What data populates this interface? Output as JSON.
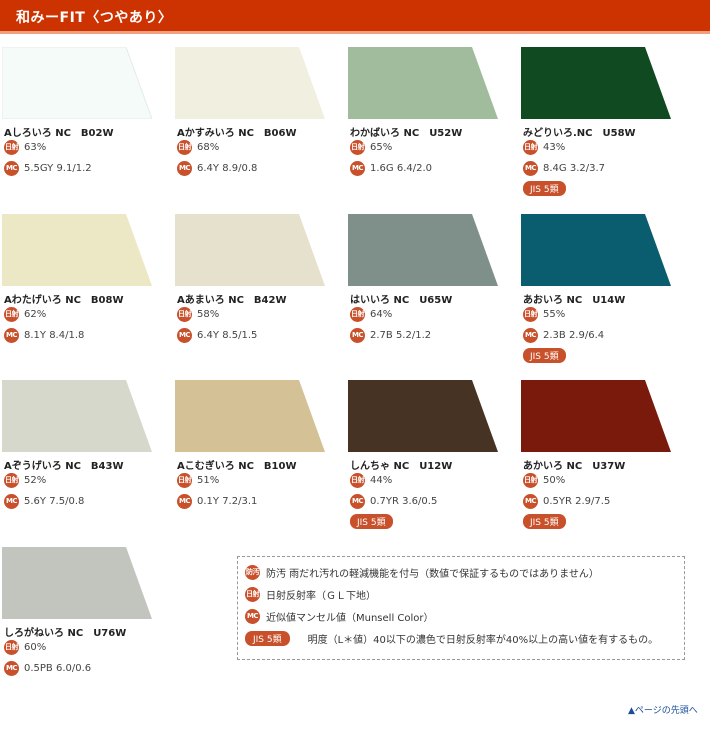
{
  "header": {
    "title": "和みーFIT〈つやあり〉"
  },
  "badges": {
    "reflect": "日射",
    "munsell": "MC",
    "stain": "防汚",
    "jis": "JIS 5類"
  },
  "colors": [
    {
      "name": "Aしろいろ NC　B02W",
      "fill": "#f4fbf8",
      "reflect": "63%",
      "munsell": "5.5GY 9.1/1.2",
      "jis": false
    },
    {
      "name": "Aかすみいろ NC　B06W",
      "fill": "#f1efe0",
      "reflect": "68%",
      "munsell": "6.4Y 8.9/0.8",
      "jis": false
    },
    {
      "name": "わかばいろ NC　U52W",
      "fill": "#a0bc9c",
      "reflect": "65%",
      "munsell": "1.6G 6.4/2.0",
      "jis": false
    },
    {
      "name": "みどりいろ.NC　U58W",
      "fill": "#0f4a21",
      "reflect": "43%",
      "munsell": "8.4G 3.2/3.7",
      "jis": true
    },
    {
      "name": "Aわたげいろ NC　B08W",
      "fill": "#ece7c4",
      "reflect": "62%",
      "munsell": "8.1Y 8.4/1.8",
      "jis": false
    },
    {
      "name": "Aあまいろ NC　B42W",
      "fill": "#e6e1cc",
      "reflect": "58%",
      "munsell": "6.4Y 8.5/1.5",
      "jis": false
    },
    {
      "name": "はいいろ NC　U65W",
      "fill": "#7f8f8a",
      "reflect": "64%",
      "munsell": "2.7B 5.2/1.2",
      "jis": false
    },
    {
      "name": "あおいろ NC　U14W",
      "fill": "#0a5d6f",
      "reflect": "55%",
      "munsell": "2.3B 2.9/6.4",
      "jis": true
    },
    {
      "name": "Aぞうげいろ NC　B43W",
      "fill": "#d5d8cb",
      "reflect": "52%",
      "munsell": "5.6Y 7.5/0.8",
      "jis": false
    },
    {
      "name": "Aこむぎいろ NC　B10W",
      "fill": "#d4c296",
      "reflect": "51%",
      "munsell": "0.1Y 7.2/3.1",
      "jis": false
    },
    {
      "name": "しんちゃ NC　U12W",
      "fill": "#463324",
      "reflect": "44%",
      "munsell": "0.7YR 3.6/0.5",
      "jis": true
    },
    {
      "name": "あかいろ NC　U37W",
      "fill": "#7a1a0d",
      "reflect": "50%",
      "munsell": "0.5YR 2.9/7.5",
      "jis": true
    },
    {
      "name": "しろがねいろ NC　U76W",
      "fill": "#c2c4be",
      "reflect": "60%",
      "munsell": "0.5PB 6.0/0.6",
      "jis": false
    }
  ],
  "legend": {
    "stain": "防汚 雨だれ汚れの軽減機能を付与（数値で保証するものではありません）",
    "reflect": "日射反射率（ＧＬ下地）",
    "munsell": "近似値マンセル値（Munsell Color）",
    "jis": "明度（L＊値）40以下の濃色で日射反射率が40%以上の高い値を有するもの。"
  },
  "page_top": "▲ページの先頭へ"
}
